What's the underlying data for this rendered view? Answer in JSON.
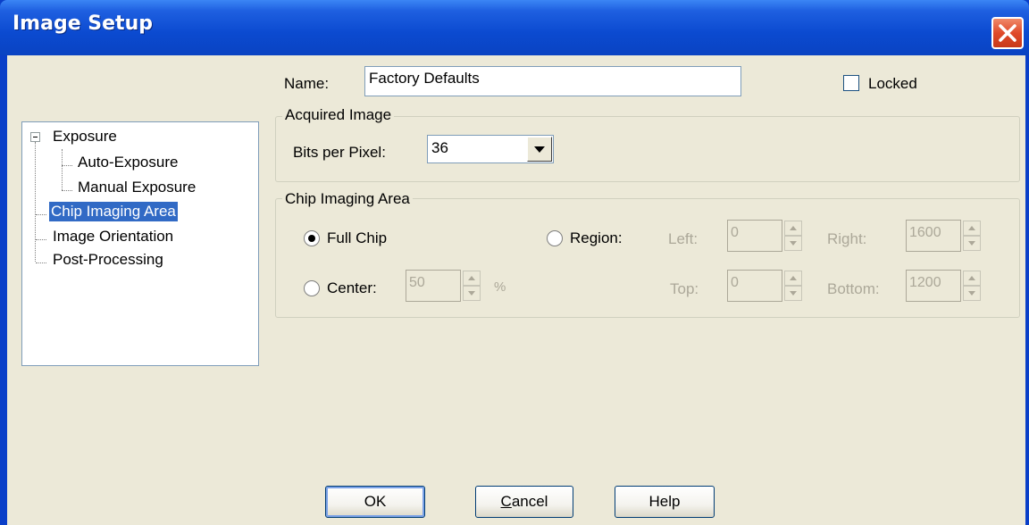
{
  "window": {
    "title": "Image Setup",
    "close_icon": "close-icon"
  },
  "form": {
    "name_label": "Name:",
    "name_value": "Factory Defaults",
    "locked_label": "Locked",
    "locked_checked": false
  },
  "tree": {
    "items": [
      {
        "label": "Exposure",
        "level": 0,
        "expanded": true,
        "selected": false
      },
      {
        "label": "Auto-Exposure",
        "level": 1,
        "selected": false
      },
      {
        "label": "Manual Exposure",
        "level": 1,
        "selected": false
      },
      {
        "label": "Chip Imaging Area",
        "level": 0,
        "selected": true
      },
      {
        "label": "Image Orientation",
        "level": 0,
        "selected": false
      },
      {
        "label": "Post-Processing",
        "level": 0,
        "selected": false
      }
    ]
  },
  "acquired": {
    "group_title": "Acquired Image",
    "bpp_label": "Bits per Pixel:",
    "bpp_value": "36"
  },
  "chip": {
    "group_title": "Chip Imaging Area",
    "full_chip_label": "Full Chip",
    "full_chip_selected": true,
    "region_label": "Region:",
    "region_selected": false,
    "center_label": "Center:",
    "center_selected": false,
    "center_value": "50",
    "percent_label": "%",
    "left_label": "Left:",
    "left_value": "0",
    "right_label": "Right:",
    "right_value": "1600",
    "top_label": "Top:",
    "top_value": "0",
    "bottom_label": "Bottom:",
    "bottom_value": "1200"
  },
  "buttons": {
    "ok": "OK",
    "cancel": "Cancel",
    "help": "Help"
  },
  "colors": {
    "titlebar": "#0a43c2",
    "selection": "#316ac5",
    "dialog_bg": "#ece9d8"
  }
}
